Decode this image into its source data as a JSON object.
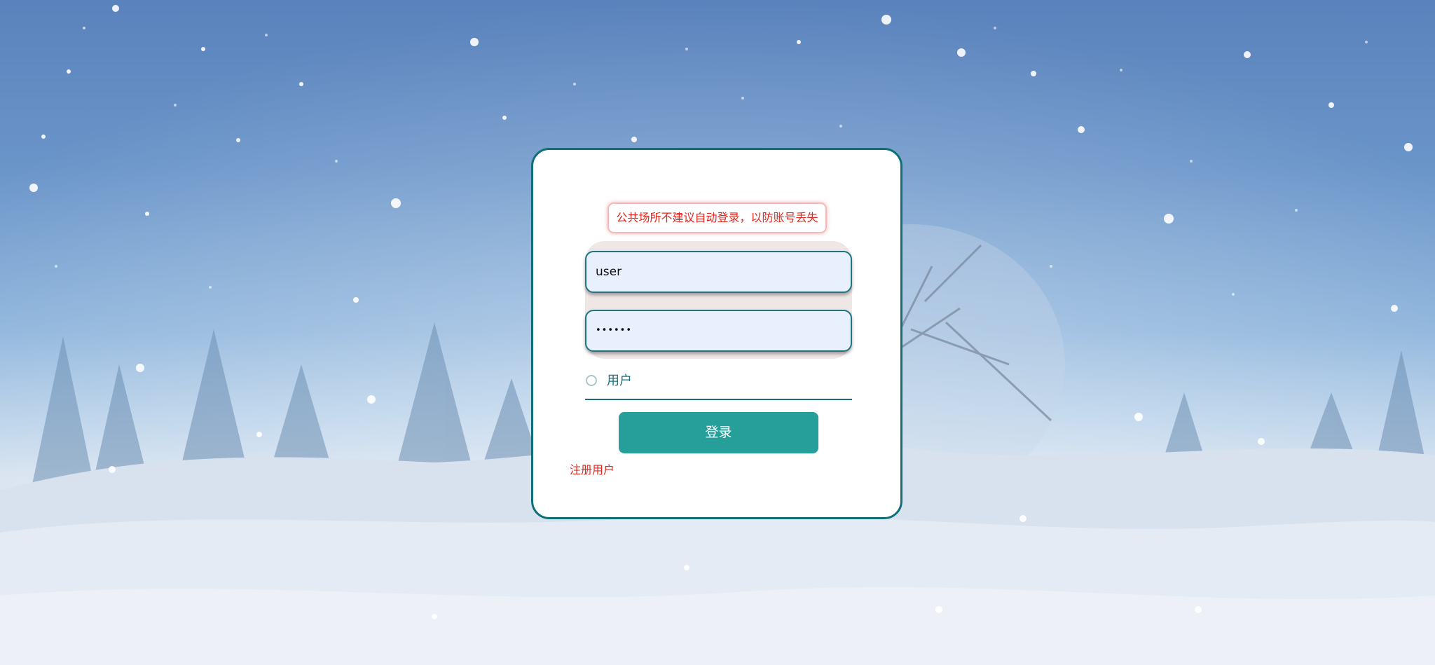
{
  "warning": {
    "text": "公共场所不建议自动登录，以防账号丢失"
  },
  "username": {
    "value": "user"
  },
  "password": {
    "value": "••••••"
  },
  "role": {
    "label": "用户",
    "selected": false
  },
  "login_button": {
    "label": "登录"
  },
  "register_link": {
    "label": "注册用户"
  },
  "colors": {
    "accent": "#269e9a",
    "border": "#0f6e78",
    "warning": "#e3261f",
    "input_bg": "#e8f0fe"
  }
}
